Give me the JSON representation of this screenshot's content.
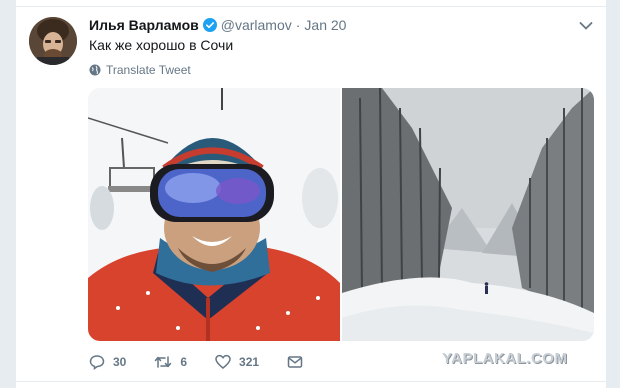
{
  "tweet": {
    "fullname": "Илья Варламов",
    "handle": "@varlamov",
    "separator": "·",
    "date": "Jan 20",
    "text": "Как же хорошо в Сочи",
    "translate_label": "Translate Tweet"
  },
  "actions": {
    "reply_count": "30",
    "retweet_count": "6",
    "like_count": "321"
  },
  "watermark": "YAPLAKAL.COM",
  "icons": {
    "verified": "verified-badge-icon",
    "caret": "chevron-down-icon",
    "globe": "globe-icon",
    "reply": "reply-icon",
    "retweet": "retweet-icon",
    "like": "heart-icon",
    "dm": "envelope-icon"
  },
  "colors": {
    "verified": "#1da1f2",
    "meta_gray": "#657786",
    "text": "#14171a"
  }
}
